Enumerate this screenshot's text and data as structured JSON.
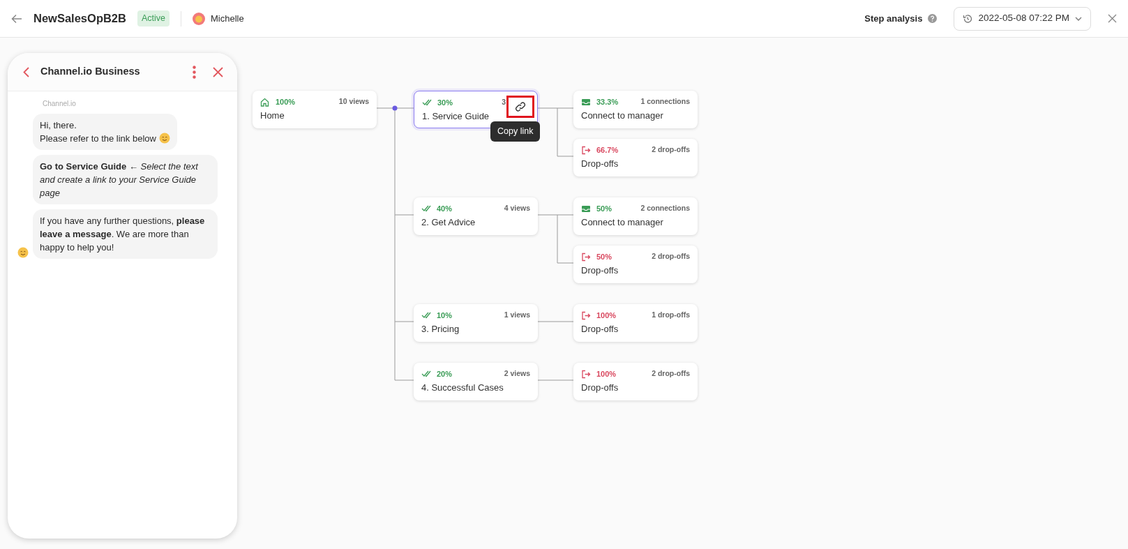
{
  "header": {
    "title": "NewSalesOpB2B",
    "status": "Active",
    "user": "Michelle",
    "analysis_label": "Step analysis",
    "date": "2022-05-08 07:22 PM"
  },
  "chat": {
    "title": "Channel.io Business",
    "sender": "Channel.io",
    "messages": [
      {
        "text": "Hi, there.\nPlease refer to the link below",
        "emoji": true,
        "avatar": false
      },
      {
        "text": "**Go to Service Guide** ← *Select the text and create a link to your Service Guide page*",
        "emoji": false,
        "avatar": false
      },
      {
        "text": "If you have any further questions, **please leave a message**. We are more than happy to help you!",
        "emoji": false,
        "avatar": true
      }
    ]
  },
  "flow": {
    "home": {
      "percent": "100%",
      "views": "10 views",
      "label": "Home"
    },
    "tooltip": "Copy link",
    "steps": [
      {
        "percent": "30%",
        "views": "3",
        "label": "1. Service Guide",
        "selected": true,
        "outcomes": [
          {
            "kind": "connect",
            "percent": "33.3%",
            "count": "1 connections",
            "label": "Connect to manager"
          },
          {
            "kind": "dropoff",
            "percent": "66.7%",
            "count": "2 drop-offs",
            "label": "Drop-offs"
          }
        ]
      },
      {
        "percent": "40%",
        "views": "4 views",
        "label": "2. Get Advice",
        "selected": false,
        "outcomes": [
          {
            "kind": "connect",
            "percent": "50%",
            "count": "2 connections",
            "label": "Connect to manager"
          },
          {
            "kind": "dropoff",
            "percent": "50%",
            "count": "2 drop-offs",
            "label": "Drop-offs"
          }
        ]
      },
      {
        "percent": "10%",
        "views": "1 views",
        "label": "3. Pricing",
        "selected": false,
        "outcomes": [
          {
            "kind": "dropoff",
            "percent": "100%",
            "count": "1 drop-offs",
            "label": "Drop-offs"
          }
        ]
      },
      {
        "percent": "20%",
        "views": "2 views",
        "label": "4. Successful Cases",
        "selected": false,
        "outcomes": [
          {
            "kind": "dropoff",
            "percent": "100%",
            "count": "2 drop-offs",
            "label": "Drop-offs"
          }
        ]
      }
    ]
  }
}
